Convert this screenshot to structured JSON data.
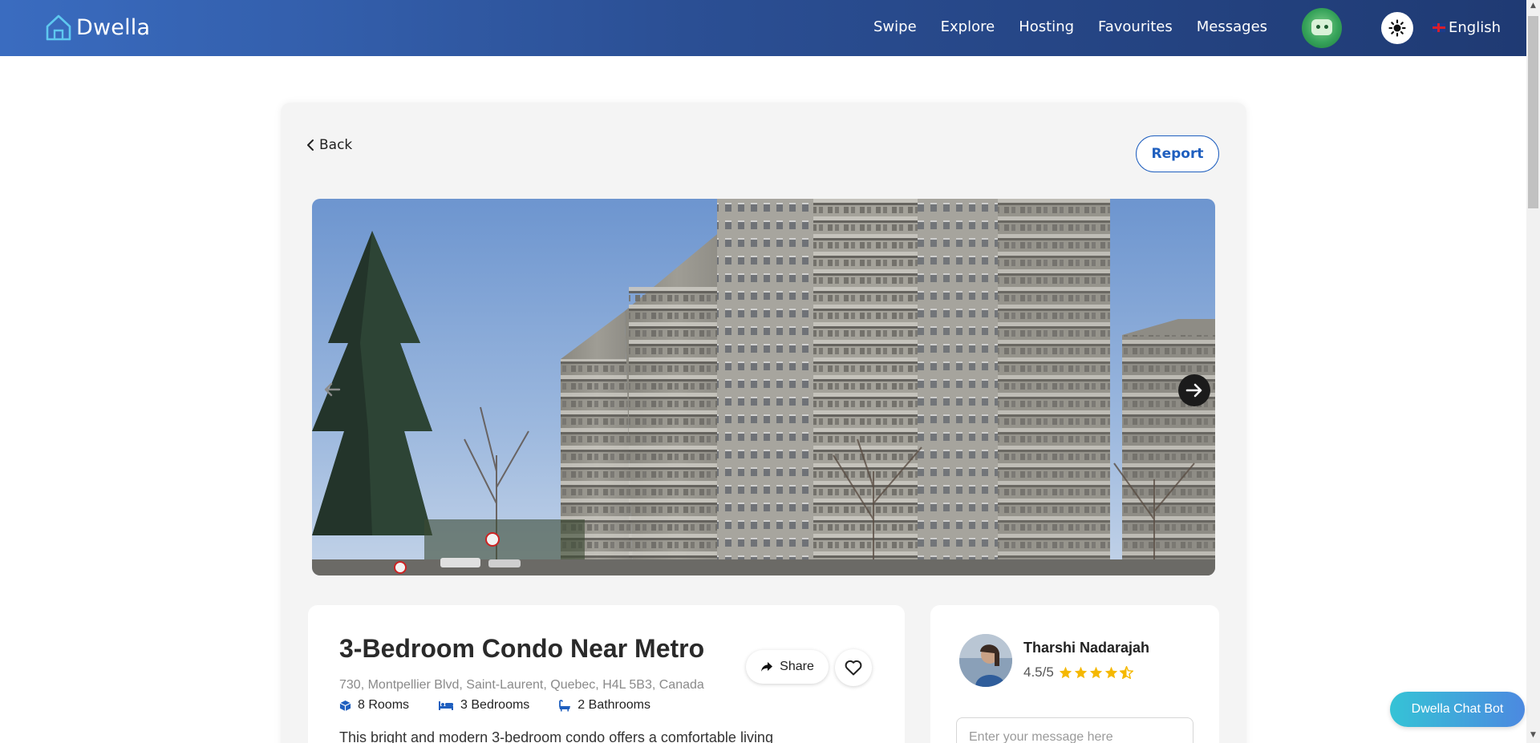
{
  "navbar": {
    "brand": "Dwella",
    "links": [
      {
        "label": "Swipe"
      },
      {
        "label": "Explore"
      },
      {
        "label": "Hosting"
      },
      {
        "label": "Favourites"
      },
      {
        "label": "Messages"
      }
    ],
    "language": "English"
  },
  "page": {
    "back_label": "Back",
    "report_label": "Report"
  },
  "listing": {
    "title": "3-Bedroom Condo Near Metro",
    "address": "730, Montpellier Blvd, Saint-Laurent, Quebec, H4L 5B3, Canada",
    "rooms": "8 Rooms",
    "bedrooms": "3 Bedrooms",
    "bathrooms": "2 Bathrooms",
    "description": "This bright and modern 3-bedroom condo offers a comfortable living",
    "share_label": "Share"
  },
  "host": {
    "name": "Tharshi Nadarajah",
    "rating_text": "4.5/5",
    "rating_value": 4.5,
    "message_placeholder": "Enter your message here"
  },
  "chatbot_label": "Dwella Chat Bot",
  "colors": {
    "accent": "#1f5fbf",
    "star": "#f5b800",
    "feature_icon": "#1f5fbf"
  }
}
